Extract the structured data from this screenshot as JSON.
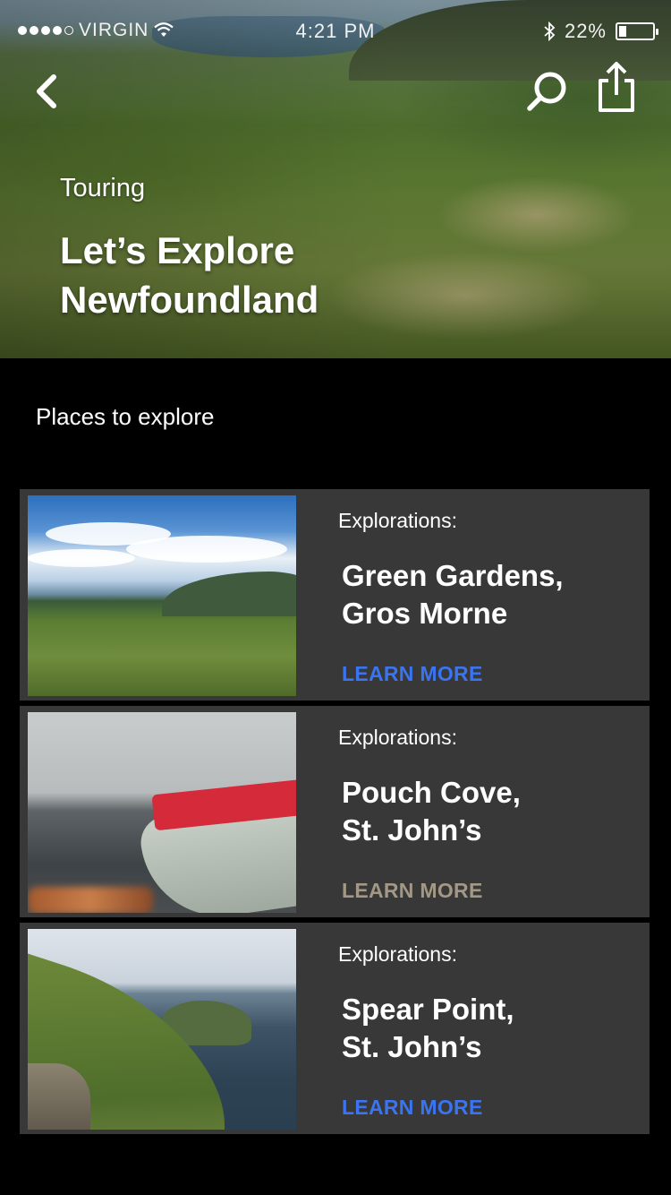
{
  "status_bar": {
    "carrier": "VIRGIN",
    "time": "4:21 PM",
    "battery": "22%",
    "signal_bars": 4
  },
  "nav": {
    "back_icon": "chevron-left-icon",
    "search_icon": "search-icon",
    "share_icon": "share-icon"
  },
  "hero": {
    "kicker": "Touring",
    "title_line1": "Let’s Explore",
    "title_line2": "Newfoundland"
  },
  "section": {
    "title": "Places to explore"
  },
  "places": [
    {
      "label": "Explorations:",
      "name_line1": "Green Gardens,",
      "name_line2": "Gros Morne",
      "cta": "LEARN MORE",
      "cta_color": "#3b74f0"
    },
    {
      "label": "Explorations:",
      "name_line1": "Pouch Cove,",
      "name_line2": "St. John’s",
      "cta": "LEARN MORE",
      "cta_color": "#a39885"
    },
    {
      "label": "Explorations:",
      "name_line1": "Spear Point,",
      "name_line2": "St. John’s",
      "cta": "LEARN MORE",
      "cta_color": "#3b74f0"
    }
  ],
  "colors": {
    "background": "#000000",
    "card": "#383838",
    "accent": "#3b74f0"
  }
}
